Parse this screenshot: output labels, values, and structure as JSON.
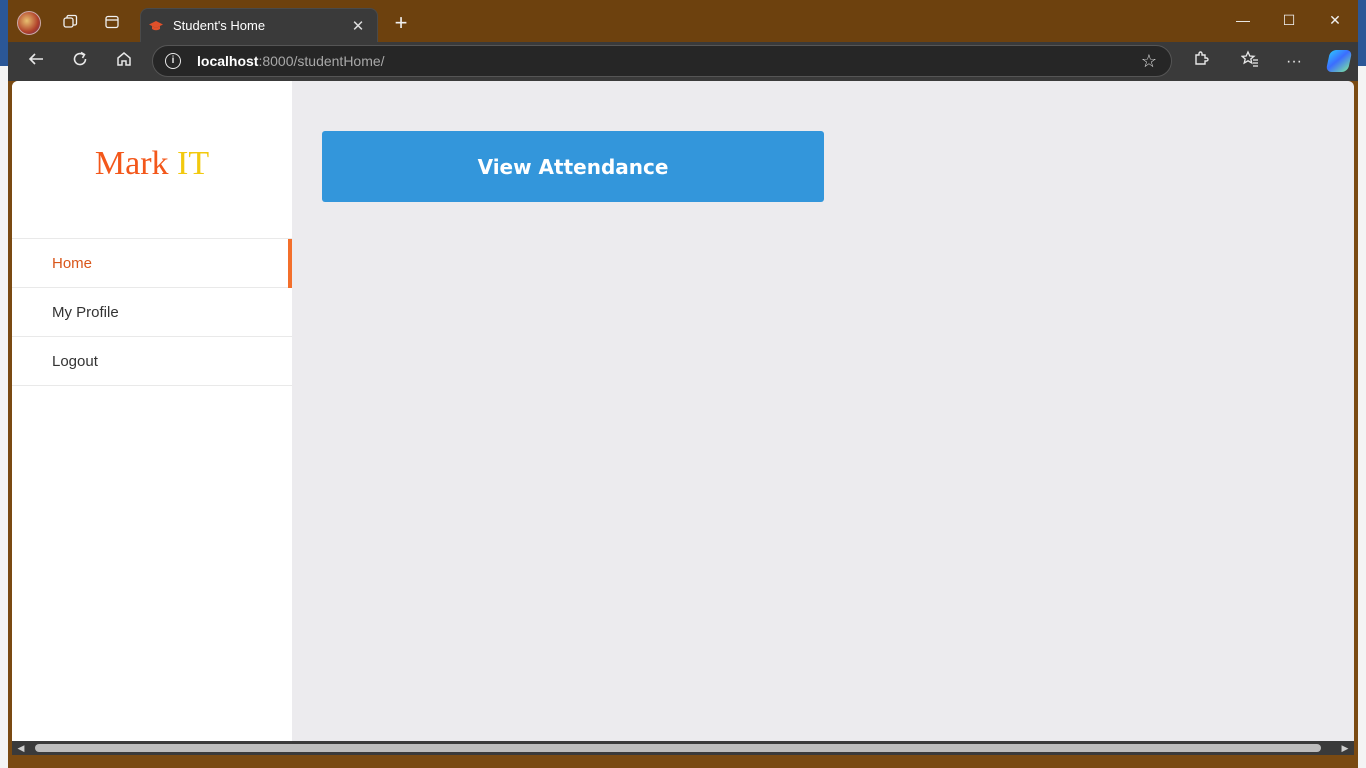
{
  "browser": {
    "tab_title": "Student's Home",
    "tab_close": "✕",
    "new_tab": "+",
    "url_host": "localhost",
    "url_rest": ":8000/studentHome/",
    "icons": {
      "back": "arrow-left-icon",
      "refresh": "refresh-icon",
      "home": "home-icon",
      "info": "info-icon",
      "favorite": "star-icon",
      "extensions": "puzzle-icon",
      "favorites": "favorites-icon",
      "more": "more-icon",
      "copilot": "copilot-icon"
    },
    "window": {
      "minimize": "—",
      "maximize": "☐",
      "close": "✕"
    }
  },
  "sidebar": {
    "logo_part1": "Mark ",
    "logo_part2": "IT",
    "items": [
      {
        "label": "Home",
        "active": true
      },
      {
        "label": "My Profile",
        "active": false
      },
      {
        "label": "Logout",
        "active": false
      }
    ]
  },
  "main": {
    "view_attendance_label": "View Attendance"
  },
  "colors": {
    "accent_orange": "#f36f2b",
    "button_blue": "#3396db",
    "logo_yellow": "#f2c90e",
    "frame_brown": "#6d410e"
  }
}
